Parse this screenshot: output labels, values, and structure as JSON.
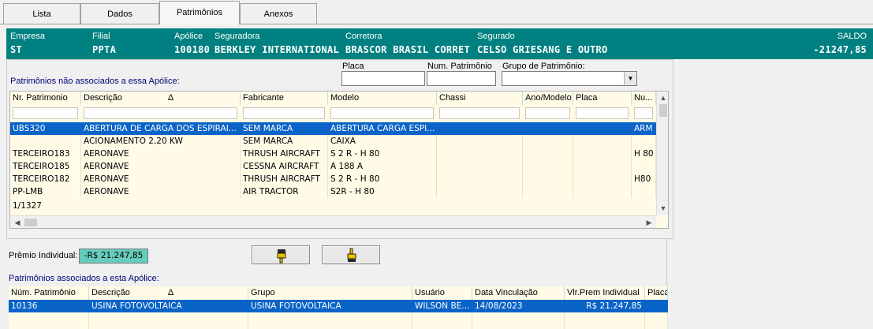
{
  "tabs": [
    {
      "label": "Lista",
      "active": false
    },
    {
      "label": "Dados",
      "active": false
    },
    {
      "label": "Patrimônios",
      "active": true
    },
    {
      "label": "Anexos",
      "active": false
    }
  ],
  "header": {
    "empresa_label": "Empresa",
    "empresa": "ST",
    "filial_label": "Filial",
    "filial": "PPTA",
    "apolice_label": "Apólice",
    "apolice": "100180",
    "seguradora_label": "Seguradora",
    "seguradora": "BERKLEY INTERNATIONAL",
    "corretora_label": "Corretora",
    "corretora": "BRASCOR BRASIL CORRET",
    "segurado_label": "Segurado",
    "segurado": "CELSO GRIESANG E OUTRO",
    "saldo_label": "SALDO",
    "saldo": "-21247,85"
  },
  "filters": {
    "placa_label": "Placa",
    "placa_value": "",
    "num_patrimonio_label": "Num. Patrimônio",
    "num_patrimonio_value": "",
    "grupo_label": "Grupo de Patrimônio:",
    "grupo_value": ""
  },
  "unassociated": {
    "title": "Patrimônios não associados a essa Apólice:",
    "sort_indicator": "Δ",
    "columns": [
      "Nr. Patrimonio",
      "Descrição",
      "Fabricante",
      "Modelo",
      "Chassi",
      "Ano/Modelo",
      "Placa",
      "Nu..."
    ],
    "rows": [
      [
        "UBS320",
        "ABERTURA DE CARGA DOS ESPIRAI...",
        "SEM MARCA",
        "ABERTURA CARGA ESPI...",
        "",
        "",
        "",
        "ARM"
      ],
      [
        "",
        "ACIONAMENTO 2,20 KW",
        "SEM MARCA",
        "CAIXA",
        "",
        "",
        "",
        ""
      ],
      [
        "TERCEIRO183",
        "AERONAVE",
        "THRUSH AIRCRAFT",
        "S 2 R - H 80",
        "",
        "",
        "",
        "H 80"
      ],
      [
        "TERCEIRO185",
        "AERONAVE",
        "CESSNA AIRCRAFT",
        "A 188 A",
        "",
        "",
        "",
        ""
      ],
      [
        "TERCEIRO182",
        "AERONAVE",
        "THRUSH AIRCRAFT",
        "S 2 R - H 80",
        "",
        "",
        "",
        "H80"
      ],
      [
        "PP-LMB",
        "AERONAVE",
        "AIR TRACTOR",
        "S2R - H 80",
        "",
        "",
        "",
        ""
      ]
    ],
    "selected_index": 0,
    "record_count": "1/1327"
  },
  "premio": {
    "label": "Prêmio Individual:",
    "value": "-R$ 21.247,85"
  },
  "buttons": {
    "associate_icon": "hand-down-icon",
    "dissociate_icon": "hand-up-icon"
  },
  "associated": {
    "title": "Patrimônios associados a esta Apólice:",
    "sort_indicator": "Δ",
    "columns": [
      "Núm. Patrimônio",
      "Descrição",
      "Grupo",
      "Usuário",
      "Data Vinculação",
      "Vlr.Prem Individual",
      "Placa"
    ],
    "rows": [
      [
        "10136",
        "USINA FOTOVOLTAICA",
        "USINA FOTOVOLTAICA",
        "WILSON BE...",
        "14/08/2023",
        "R$ 21.247,85",
        ""
      ]
    ],
    "selected_index": 0
  },
  "colors": {
    "header_teal": "#008080",
    "selection_blue": "#0a64c8",
    "grid_bg": "#fffbe6",
    "premio_bg": "#66ccbb"
  }
}
